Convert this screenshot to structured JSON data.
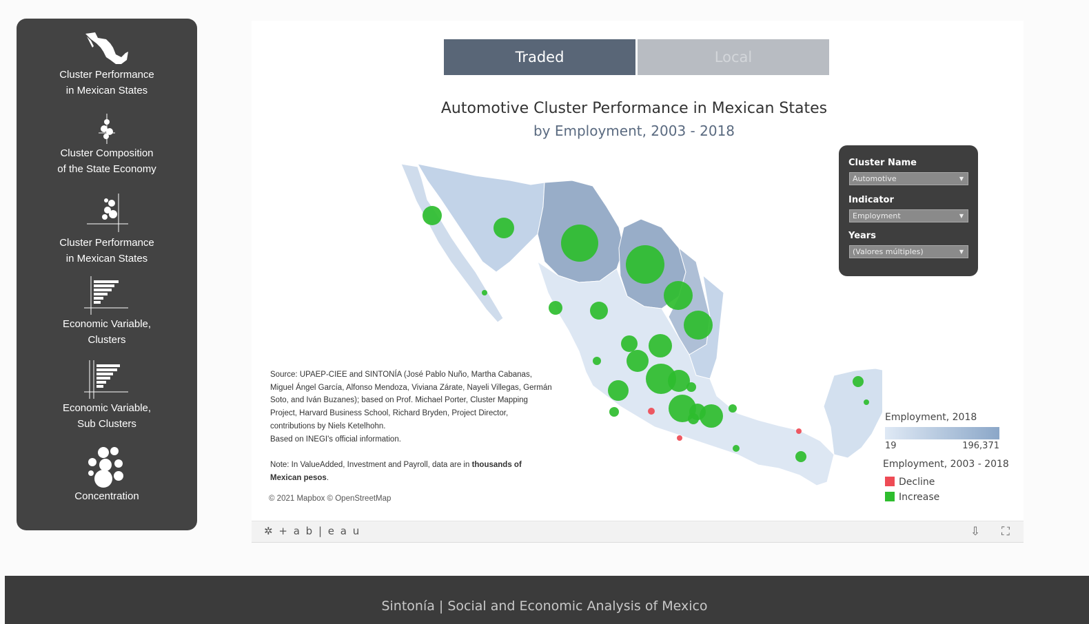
{
  "sidebar": {
    "items": [
      {
        "icon": "mexico-map-icon",
        "label": "Cluster Performance\nin Mexican States"
      },
      {
        "icon": "bubble-stack-icon",
        "label": "Cluster Composition\nof the State Economy"
      },
      {
        "icon": "bubble-quadrant-icon",
        "label": "Cluster Performance\nin Mexican States"
      },
      {
        "icon": "bar-chart-icon",
        "label": "Economic Variable,\nClusters"
      },
      {
        "icon": "bar-chart-lines-icon",
        "label": "Economic Variable,\nSub Clusters"
      },
      {
        "icon": "bubbles-icon",
        "label": "Concentration"
      }
    ]
  },
  "tabs": {
    "traded": "Traded",
    "local": "Local"
  },
  "viz": {
    "title": "Automotive Cluster Performance in Mexican States",
    "subtitle": "by Employment, 2003 - 2018"
  },
  "filters": {
    "cluster_label": "Cluster Name",
    "cluster_value": "Automotive",
    "indicator_label": "Indicator",
    "indicator_value": "Employment",
    "years_label": "Years",
    "years_value": "(Valores múltiples)"
  },
  "source": {
    "text": "Source: UPAEP-CIEE and SINTONÍA (José Pablo Nuño, Martha Cabanas, Miguel Ángel García, Alfonso Mendoza, Viviana Zárate, Nayeli Villegas, Germán Soto, and Iván Buzanes); based on Prof. Michael Porter, Cluster Mapping Project, Harvard Business School, Richard Bryden, Project Director, contributions by Niels Ketelhohn.",
    "inegi": "Based on INEGI's official information.",
    "note_prefix": "Note: In ValueAdded, Investment and Payroll, data are in ",
    "note_bold": "thousands of Mexican pesos",
    "note_suffix": ".",
    "map_credit": "© 2021 Mapbox  © OpenStreetMap"
  },
  "legend": {
    "gradient_title": "Employment, 2018",
    "gradient_min": "19",
    "gradient_max": "196,371",
    "gradient_colors": [
      "#dfe9f5",
      "#8ba7c8"
    ],
    "change_title": "Employment, 2003 - 2018",
    "decline": "Decline",
    "increase": "Increase",
    "decline_color": "#ee4b55",
    "increase_color": "#2ebd2e"
  },
  "toolbar": {
    "logo": "+ a b | e a u",
    "share_icon": "share-icon",
    "fullscreen_icon": "fullscreen-icon"
  },
  "footer": {
    "text": "Sintonía | Social and Economic Analysis of Mexico"
  }
}
